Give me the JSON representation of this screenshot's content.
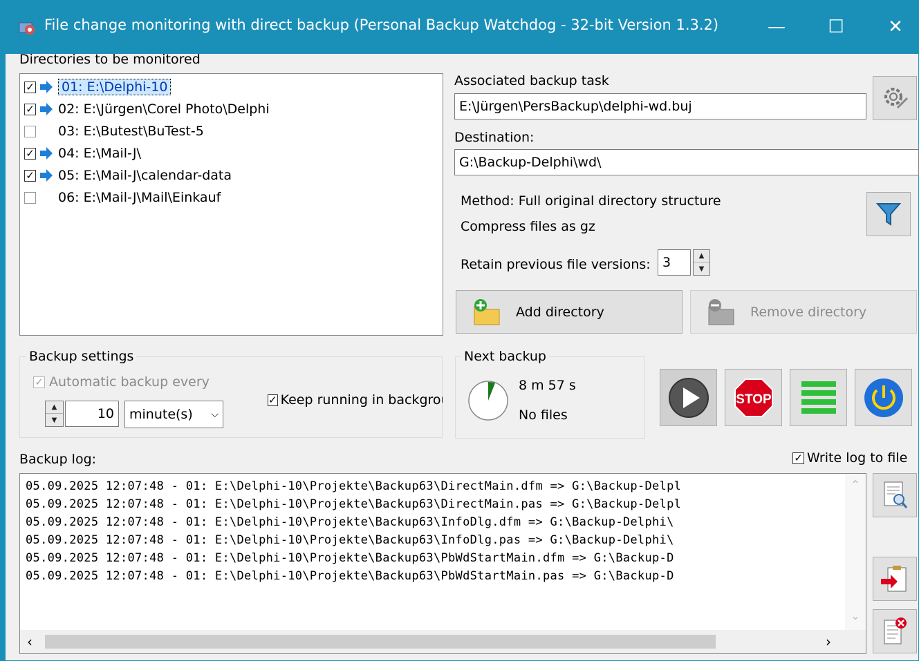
{
  "window": {
    "title": "File change monitoring with direct backup (Personal Backup Watchdog - 32-bit Version 1.3.2)",
    "minimize": "—",
    "maximize": "☐",
    "close": "✕"
  },
  "directories": {
    "label": "Directories to be monitored",
    "items": [
      {
        "text": "01: E:\\Delphi-10",
        "checked": true,
        "active": true
      },
      {
        "text": "02: E:\\Jürgen\\Corel Photo\\Delphi",
        "checked": true,
        "active": true
      },
      {
        "text": "03: E:\\Butest\\BuTest-5",
        "checked": false,
        "active": false
      },
      {
        "text": "04: E:\\Mail-J\\",
        "checked": true,
        "active": true
      },
      {
        "text": "05: E:\\Mail-J\\calendar-data",
        "checked": true,
        "active": true
      },
      {
        "text": "06: E:\\Mail-J\\Mail\\Einkauf",
        "checked": false,
        "active": false
      }
    ]
  },
  "task": {
    "label": "Associated backup task",
    "value": "E:\\Jürgen\\PersBackup\\delphi-wd.buj",
    "dest_label": "Destination:",
    "dest_value": "G:\\Backup-Delphi\\wd\\",
    "method": "Method:  Full original directory structure",
    "compress": "Compress files as gz",
    "retain_label": "Retain previous file versions:",
    "retain_value": "3"
  },
  "buttons": {
    "add": "Add directory",
    "remove": "Remove directory"
  },
  "settings": {
    "title": "Backup settings",
    "auto": "Automatic backup every",
    "interval": "10",
    "unit": "minute(s)",
    "keep": "Keep running in backgrou"
  },
  "next": {
    "title": "Next backup",
    "time": "8 m 57 s",
    "files": "No files"
  },
  "log": {
    "label": "Backup log:",
    "write": "Write log to file",
    "lines": [
      "05.09.2025 12:07:48 - 01: E:\\Delphi-10\\Projekte\\Backup63\\DirectMain.dfm => G:\\Backup-Delpl",
      "05.09.2025 12:07:48 - 01: E:\\Delphi-10\\Projekte\\Backup63\\DirectMain.pas => G:\\Backup-Delpl",
      "05.09.2025 12:07:48 - 01: E:\\Delphi-10\\Projekte\\Backup63\\InfoDlg.dfm => G:\\Backup-Delphi\\",
      "05.09.2025 12:07:48 - 01: E:\\Delphi-10\\Projekte\\Backup63\\InfoDlg.pas => G:\\Backup-Delphi\\",
      "05.09.2025 12:07:48 - 01: E:\\Delphi-10\\Projekte\\Backup63\\PbWdStartMain.dfm => G:\\Backup-D",
      "05.09.2025 12:07:48 - 01: E:\\Delphi-10\\Projekte\\Backup63\\PbWdStartMain.pas => G:\\Backup-D"
    ]
  },
  "colors": {
    "titlebar": "#1a8fb8",
    "arrow": "#1e7fd8",
    "stop": "#d9001b",
    "power": "#1e6fd8",
    "green": "#2fbf3a"
  }
}
